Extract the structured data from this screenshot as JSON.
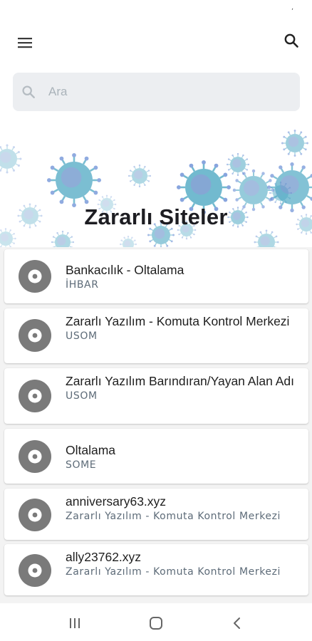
{
  "status_bar": {
    "indicator": "ʼ"
  },
  "header": {
    "menu_icon": "hamburger-menu-icon",
    "search_icon": "search-icon"
  },
  "search": {
    "placeholder": "Ara",
    "value": ""
  },
  "banner": {
    "title": "Zararlı Siteler",
    "accent": "#4fa9c4"
  },
  "items": [
    {
      "title": "Bankacılık - Oltalama",
      "subtitle": "İHBAR"
    },
    {
      "title": "Zararlı Yazılım - Komuta Kontrol Merkezi",
      "subtitle": "USOM"
    },
    {
      "title": "Zararlı Yazılım Barındıran/Yayan Alan Adı",
      "subtitle": "USOM"
    },
    {
      "title": "Oltalama",
      "subtitle": "SOME"
    },
    {
      "title": "anniversary63.xyz",
      "subtitle": "Zararlı Yazılım - Komuta Kontrol Merkezi"
    },
    {
      "title": "ally23762.xyz",
      "subtitle": "Zararlı Yazılım - Komuta Kontrol Merkezi"
    }
  ],
  "nav": {
    "recent_icon": "recent-apps-icon",
    "home_icon": "home-icon",
    "back_icon": "back-icon"
  }
}
